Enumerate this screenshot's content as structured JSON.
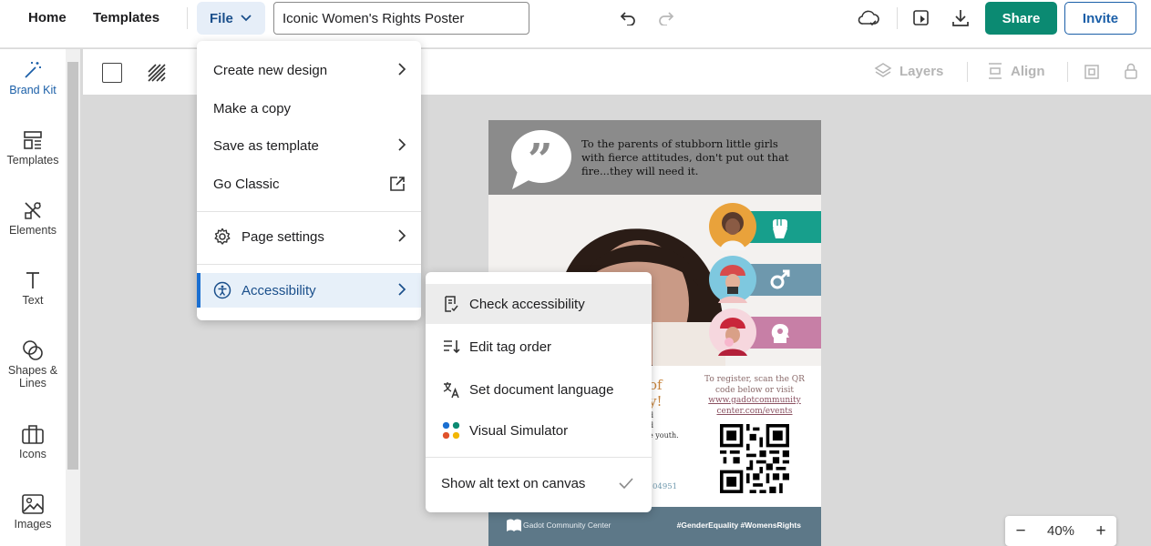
{
  "topbar": {
    "home_label": "Home",
    "templates_label": "Templates",
    "file_label": "File",
    "document_title": "Iconic Women's Rights Poster",
    "share_label": "Share",
    "invite_label": "Invite"
  },
  "sidebar": {
    "items": [
      {
        "label": "Brand Kit",
        "icon": "magic-wand-icon"
      },
      {
        "label": "Templates",
        "icon": "templates-icon"
      },
      {
        "label": "Elements",
        "icon": "elements-icon"
      },
      {
        "label": "Text",
        "icon": "text-icon"
      },
      {
        "label": "Shapes & Lines",
        "icon": "shapes-icon"
      },
      {
        "label": "Icons",
        "icon": "briefcase-icon"
      },
      {
        "label": "Images",
        "icon": "image-icon"
      }
    ]
  },
  "toolbar": {
    "layers_label": "Layers",
    "align_label": "Align"
  },
  "file_menu": {
    "items": [
      {
        "label": "Create new design",
        "trailing": "chevron-right-icon"
      },
      {
        "label": "Make a copy"
      },
      {
        "label": "Save as template",
        "trailing": "chevron-right-icon"
      },
      {
        "label": "Go Classic",
        "trailing": "external-link-icon"
      },
      {
        "label": "Page settings",
        "icon": "gear-icon",
        "trailing": "chevron-right-icon"
      },
      {
        "label": "Accessibility",
        "icon": "accessibility-icon",
        "trailing": "chevron-right-icon",
        "selected": true
      }
    ]
  },
  "accessibility_menu": {
    "items": [
      {
        "label": "Check accessibility",
        "icon": "checklist-icon"
      },
      {
        "label": "Edit tag order",
        "icon": "tag-order-icon"
      },
      {
        "label": "Set document language",
        "icon": "translate-icon"
      },
      {
        "label": "Visual Simulator",
        "icon": "color-dots-icon"
      },
      {
        "label": "Show alt text on canvas",
        "trailing": "checkmark-icon"
      }
    ]
  },
  "poster": {
    "quote": "To the parents of stubborn little girls with fierce attitudes, don't put out that fire...they will need it.",
    "register_line1": "To register, scan the QR code below or visit",
    "register_link": "www.gadotcommunity center.com/events",
    "footer_left": "Gadot Community Center",
    "footer_right": "#GenderEquality #WomensRights",
    "partial_heading_1": "of",
    "partial_heading_2": "y!",
    "partial_body_1": "d",
    "partial_body_2": "d",
    "partial_body_3": "e youth.",
    "partial_phone": "04951"
  },
  "zoom": {
    "minus": "−",
    "value": "40",
    "unit": "%",
    "plus": "+"
  },
  "colors": {
    "accent": "#1b5fa8",
    "share": "#0b8a72",
    "poster_teal": "#179f8c",
    "poster_blue": "#6e98ad",
    "poster_pink": "#c77fa6",
    "poster_footer": "#5d7888"
  }
}
